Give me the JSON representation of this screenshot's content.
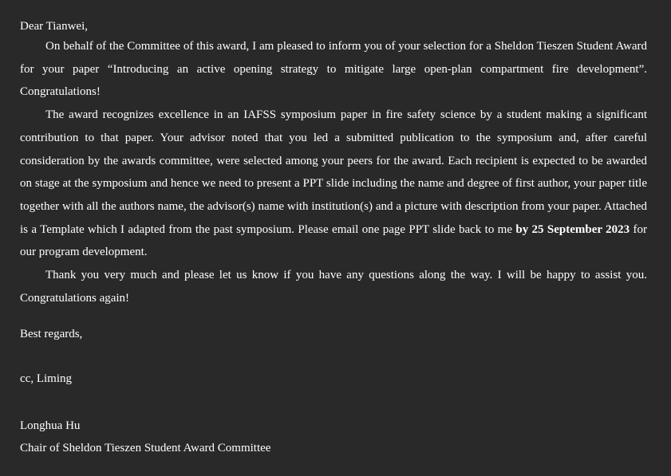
{
  "letter": {
    "salutation": "Dear Tianwei,",
    "paragraph1": "On behalf of the Committee of this award, I am pleased to inform you of your selection for a Sheldon Tieszen Student Award for your paper “Introducing an active opening strategy to mitigate large open-plan compartment fire development”. Congratulations!",
    "paragraph2_text": "The award recognizes excellence in an IAFSS symposium paper in fire safety science by a student making a significant contribution to that paper. Your advisor noted that you led a submitted publication to the symposium and, after careful consideration by the awards committee, were selected among your peers for the award. Each recipient is expected to be awarded on stage at the symposium and hence we need to present a PPT slide including the name and degree of first author, your paper title together with all the authors name, the advisor(s) name with institution(s) and a picture with description from your paper. Attached is a Template which I adapted from the past symposium. Please email one page PPT slide back to me ",
    "paragraph2_deadline": "by 25 September 2023",
    "paragraph2_tail": " for our program development.",
    "paragraph3": "Thank you very much and please let us know if you have any questions along the way. I will be happy to assist you. Congratulations again!",
    "closing": "Best regards,",
    "cc": "cc, Liming",
    "signature_name": "Longhua Hu",
    "signature_title": "Chair of Sheldon Tieszen Student Award Committee"
  }
}
